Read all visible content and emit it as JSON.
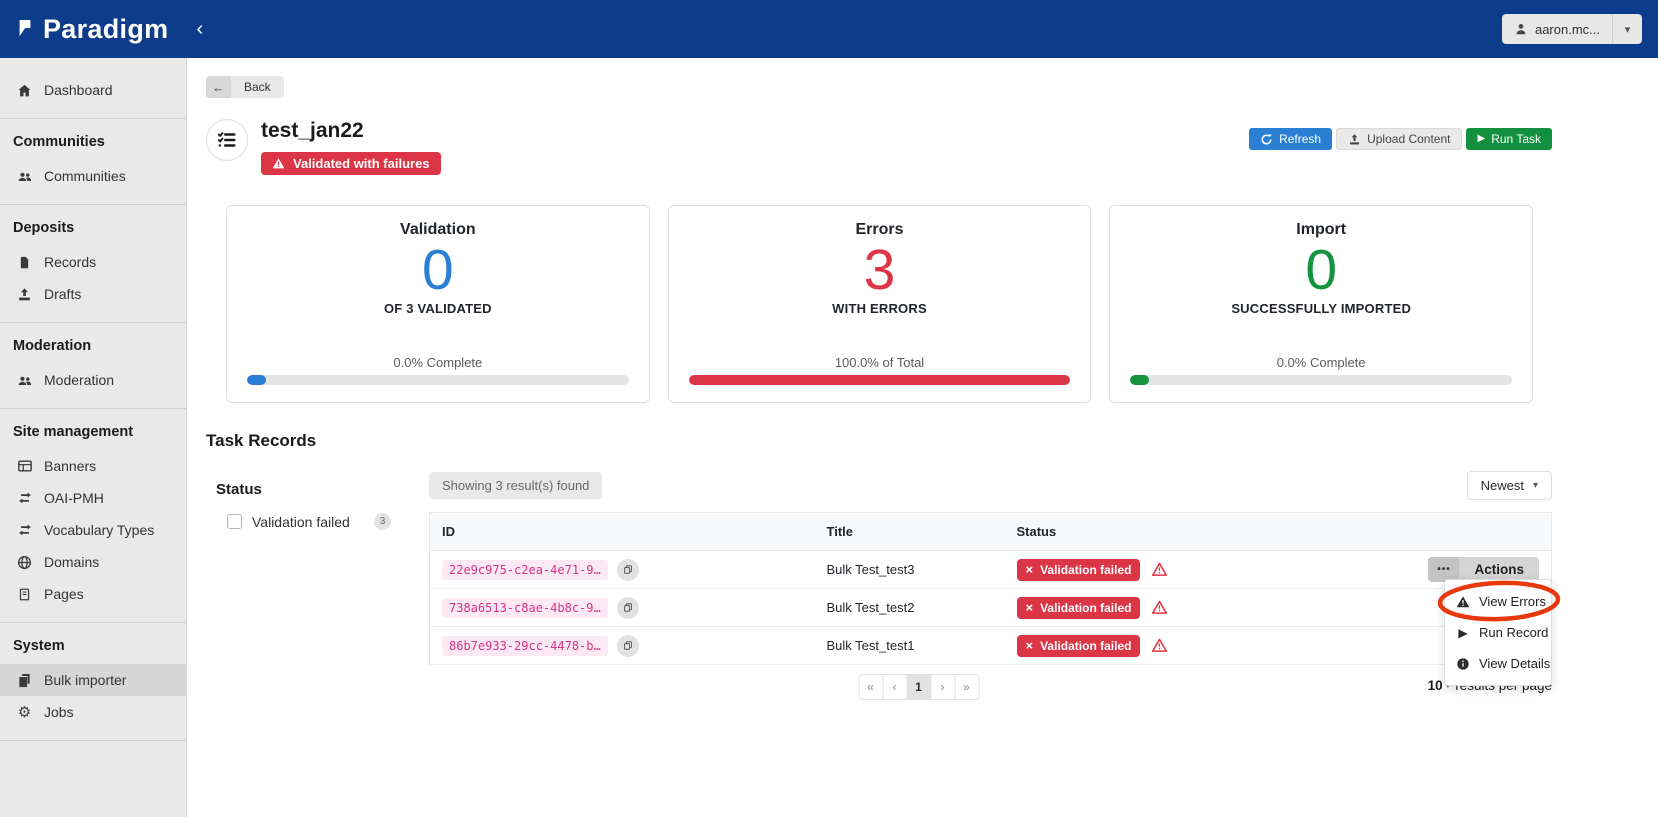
{
  "header": {
    "brand": "Paradigm",
    "user_label": "aaron.mc..."
  },
  "icons": {
    "collapse": "‹",
    "caret_down": "▾",
    "back_arrow": "←",
    "ellipsis": "•••",
    "close": "×",
    "play": "▶",
    "pag_first": "«",
    "pag_prev": "‹",
    "pag_next": "›",
    "pag_last": "»",
    "gear": "⚙"
  },
  "back_label": "Back",
  "page": {
    "title": "test_jan22",
    "status_badge": "Validated with failures"
  },
  "toolbar": {
    "refresh": "Refresh",
    "upload": "Upload Content",
    "run_task": "Run Task"
  },
  "cards": [
    {
      "title": "Validation",
      "value": "0",
      "subtitle": "OF 3 VALIDATED",
      "progress_label": "0.0% Complete",
      "progress_pct": 5,
      "accent": "#2a7fd4"
    },
    {
      "title": "Errors",
      "value": "3",
      "subtitle": "WITH ERRORS",
      "progress_label": "100.0% of Total",
      "progress_pct": 100,
      "accent": "#dc3545"
    },
    {
      "title": "Import",
      "value": "0",
      "subtitle": "SUCCESSFULLY IMPORTED",
      "progress_label": "0.0% Complete",
      "progress_pct": 5,
      "accent": "#16933e"
    }
  ],
  "task_records": {
    "heading": "Task Records",
    "filter_heading": "Status",
    "filter": {
      "label": "Validation failed",
      "count": "3"
    },
    "results_summary": "Showing 3 result(s) found",
    "sort_label": "Newest",
    "columns": [
      "ID",
      "Title",
      "Status"
    ],
    "rows": [
      {
        "id": "22e9c975-c2ea-4e71-9…",
        "title": "Bulk Test_test3",
        "status": "Validation failed"
      },
      {
        "id": "738a6513-c8ae-4b8c-9…",
        "title": "Bulk Test_test2",
        "status": "Validation failed"
      },
      {
        "id": "86b7e933-29cc-4478-b…",
        "title": "Bulk Test_test1",
        "status": "Validation failed"
      }
    ],
    "actions_label": "Actions",
    "menu": [
      {
        "label": "View Errors"
      },
      {
        "label": "Run Record"
      },
      {
        "label": "View Details"
      }
    ],
    "pagination": {
      "page": "1"
    },
    "per_page_count": "10",
    "per_page_label": "results per page"
  },
  "sidebar": {
    "top_items": [
      {
        "label": "Dashboard"
      }
    ],
    "sections": [
      {
        "heading": "Communities",
        "items": [
          {
            "label": "Communities"
          }
        ]
      },
      {
        "heading": "Deposits",
        "items": [
          {
            "label": "Records"
          },
          {
            "label": "Drafts"
          }
        ]
      },
      {
        "heading": "Moderation",
        "items": [
          {
            "label": "Moderation"
          }
        ]
      },
      {
        "heading": "Site management",
        "items": [
          {
            "label": "Banners"
          },
          {
            "label": "OAI-PMH"
          },
          {
            "label": "Vocabulary Types"
          },
          {
            "label": "Domains"
          },
          {
            "label": "Pages"
          }
        ]
      },
      {
        "heading": "System",
        "items": [
          {
            "label": "Bulk importer"
          },
          {
            "label": "Jobs"
          }
        ]
      }
    ]
  },
  "colors": {
    "header_bg": "#0c3c8a",
    "danger": "#dc3545",
    "primary": "#2a7fd4",
    "success": "#16933e",
    "id_pink": "#d63384",
    "annotation_red": "#e8380d"
  }
}
